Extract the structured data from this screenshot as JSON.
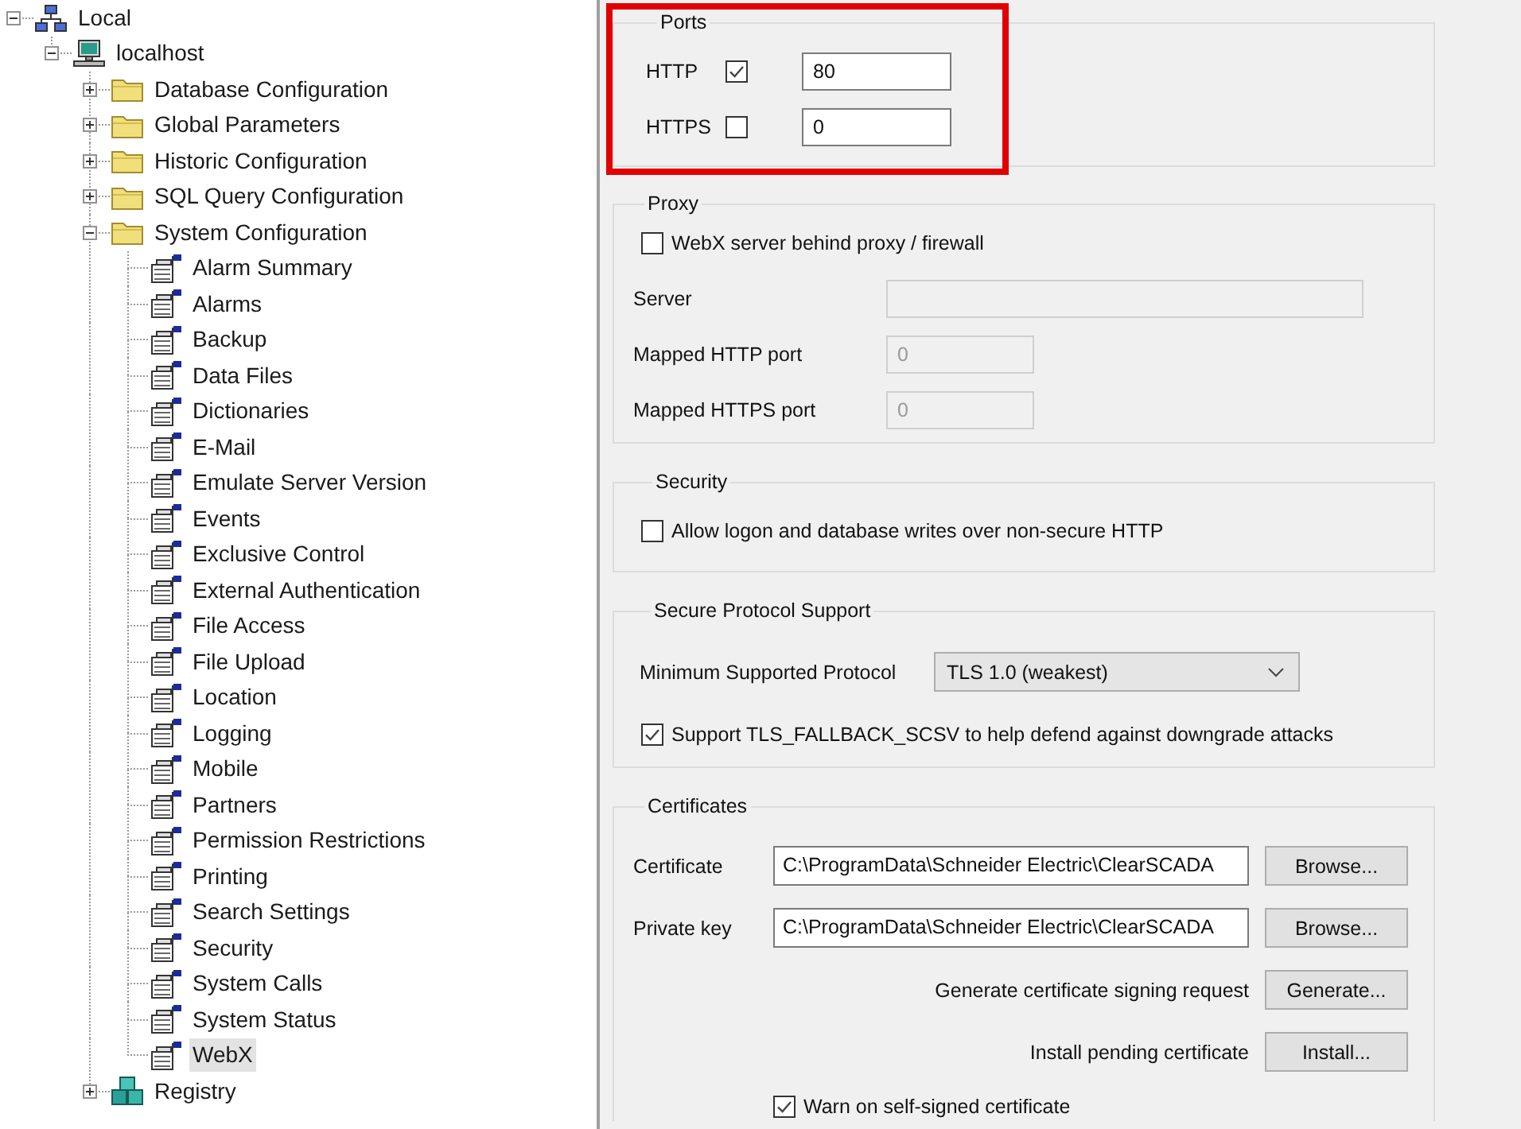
{
  "tree": {
    "nodes": [
      {
        "label": "Local",
        "kind": "network",
        "expanded": true,
        "selected": false,
        "children": [
          {
            "label": "localhost",
            "kind": "computer",
            "expanded": true,
            "selected": false,
            "children": [
              {
                "label": "Database Configuration",
                "kind": "folder",
                "expanded": false,
                "selected": false
              },
              {
                "label": "Global Parameters",
                "kind": "folder",
                "expanded": false,
                "selected": false
              },
              {
                "label": "Historic Configuration",
                "kind": "folder",
                "expanded": false,
                "selected": false
              },
              {
                "label": "SQL Query Configuration",
                "kind": "folder",
                "expanded": false,
                "selected": false
              },
              {
                "label": "System Configuration",
                "kind": "folder",
                "expanded": true,
                "selected": false,
                "children": [
                  {
                    "label": "Alarm Summary",
                    "kind": "setting",
                    "selected": false
                  },
                  {
                    "label": "Alarms",
                    "kind": "setting",
                    "selected": false
                  },
                  {
                    "label": "Backup",
                    "kind": "setting",
                    "selected": false
                  },
                  {
                    "label": "Data Files",
                    "kind": "setting",
                    "selected": false
                  },
                  {
                    "label": "Dictionaries",
                    "kind": "setting",
                    "selected": false
                  },
                  {
                    "label": "E-Mail",
                    "kind": "setting",
                    "selected": false
                  },
                  {
                    "label": "Emulate Server Version",
                    "kind": "setting",
                    "selected": false
                  },
                  {
                    "label": "Events",
                    "kind": "setting",
                    "selected": false
                  },
                  {
                    "label": "Exclusive Control",
                    "kind": "setting",
                    "selected": false
                  },
                  {
                    "label": "External Authentication",
                    "kind": "setting",
                    "selected": false
                  },
                  {
                    "label": "File Access",
                    "kind": "setting",
                    "selected": false
                  },
                  {
                    "label": "File Upload",
                    "kind": "setting",
                    "selected": false
                  },
                  {
                    "label": "Location",
                    "kind": "setting",
                    "selected": false
                  },
                  {
                    "label": "Logging",
                    "kind": "setting",
                    "selected": false
                  },
                  {
                    "label": "Mobile",
                    "kind": "setting",
                    "selected": false
                  },
                  {
                    "label": "Partners",
                    "kind": "setting",
                    "selected": false
                  },
                  {
                    "label": "Permission Restrictions",
                    "kind": "setting",
                    "selected": false
                  },
                  {
                    "label": "Printing",
                    "kind": "setting",
                    "selected": false
                  },
                  {
                    "label": "Search Settings",
                    "kind": "setting",
                    "selected": false
                  },
                  {
                    "label": "Security",
                    "kind": "setting",
                    "selected": false
                  },
                  {
                    "label": "System Calls",
                    "kind": "setting",
                    "selected": false
                  },
                  {
                    "label": "System Status",
                    "kind": "setting",
                    "selected": false
                  },
                  {
                    "label": "WebX",
                    "kind": "setting",
                    "selected": true
                  }
                ]
              },
              {
                "label": "Registry",
                "kind": "registry",
                "expanded": false,
                "selected": false
              }
            ]
          }
        ]
      }
    ]
  },
  "ports": {
    "title": "Ports",
    "highlighted": true,
    "rows": [
      {
        "label": "HTTP",
        "checked": true,
        "value": "80"
      },
      {
        "label": "HTTPS",
        "checked": false,
        "value": "0"
      }
    ]
  },
  "proxy": {
    "title": "Proxy",
    "option": {
      "label": "WebX server behind proxy / firewall",
      "checked": false
    },
    "fields": [
      {
        "label": "Server",
        "kind": "host",
        "disabled": true
      },
      {
        "label": "Mapped HTTP port",
        "kind": "port",
        "value": "0",
        "disabled": true
      },
      {
        "label": "Mapped HTTPS port",
        "kind": "port",
        "value": "0",
        "disabled": true
      }
    ]
  },
  "security": {
    "title": "Security",
    "option": {
      "label": "Allow logon and database writes over non-secure HTTP",
      "checked": false
    }
  },
  "protocol": {
    "title": "Secure Protocol Support",
    "label": "Minimum Supported Protocol",
    "value": "TLS 1.0 (weakest)",
    "option": {
      "label": "Support TLS_FALLBACK_SCSV to help defend against downgrade attacks",
      "checked": true
    }
  },
  "certificates": {
    "title": "Certificates",
    "files": [
      {
        "label": "Certificate",
        "value": "C:\\ProgramData\\Schneider Electric\\ClearSCADA",
        "button": "Browse..."
      },
      {
        "label": "Private key",
        "value": "C:\\ProgramData\\Schneider Electric\\ClearSCADA",
        "button": "Browse..."
      }
    ],
    "actions": [
      {
        "label": "Generate certificate signing request",
        "button": "Generate..."
      },
      {
        "label": "Install pending certificate",
        "button": "Install..."
      }
    ],
    "option": {
      "label": "Warn on self-signed certificate",
      "checked": true
    }
  }
}
